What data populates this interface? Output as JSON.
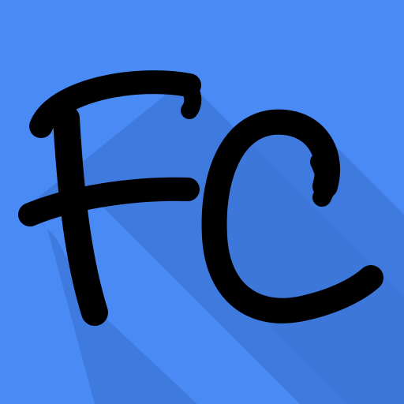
{
  "icon": {
    "monogram": "FC",
    "background_color": "#4a8af4",
    "long_shadow_color": "#3d77d9",
    "glyph_color": "#000000"
  }
}
